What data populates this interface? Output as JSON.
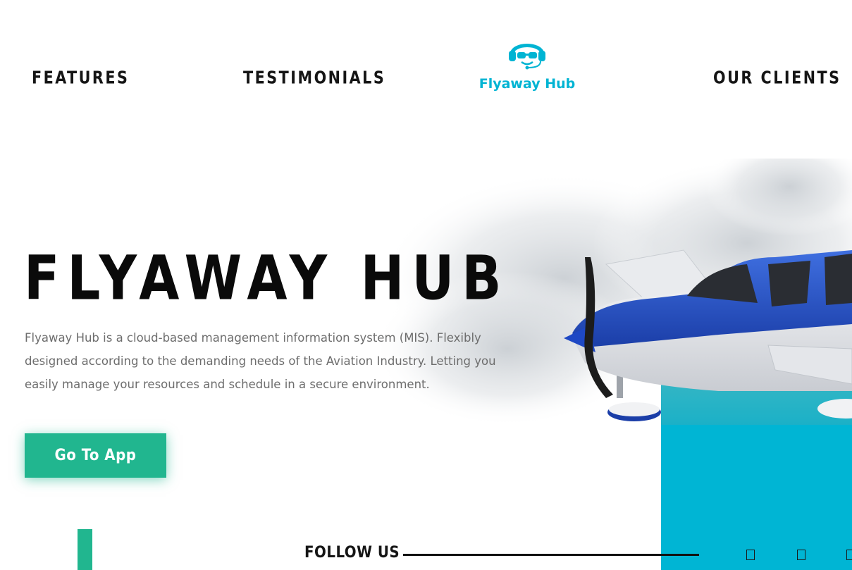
{
  "nav": {
    "features": "FEATURES",
    "testimonials": "TESTIMONIALS",
    "clients": "OUR CLIENTS"
  },
  "brand": {
    "name": "Flyaway Hub",
    "icon": "pilot-headset-icon",
    "color": "#00b4d3"
  },
  "hero": {
    "title": "FLYAWAY HUB",
    "description": "Flyaway Hub is a cloud-based management information system (MIS). Flexibly designed according to the demanding needs of the Aviation Industry. Letting you easily manage your resources and schedule in a secure environment.",
    "cta_label": "Go To App",
    "image": "airplane-over-clouds"
  },
  "footer": {
    "follow_label": "FOLLOW US",
    "social_icons": [
      "social-icon-1",
      "social-icon-2",
      "social-icon-3"
    ]
  },
  "colors": {
    "accent_green": "#21b68f",
    "accent_teal": "#00b5d4",
    "text": "#151515"
  }
}
